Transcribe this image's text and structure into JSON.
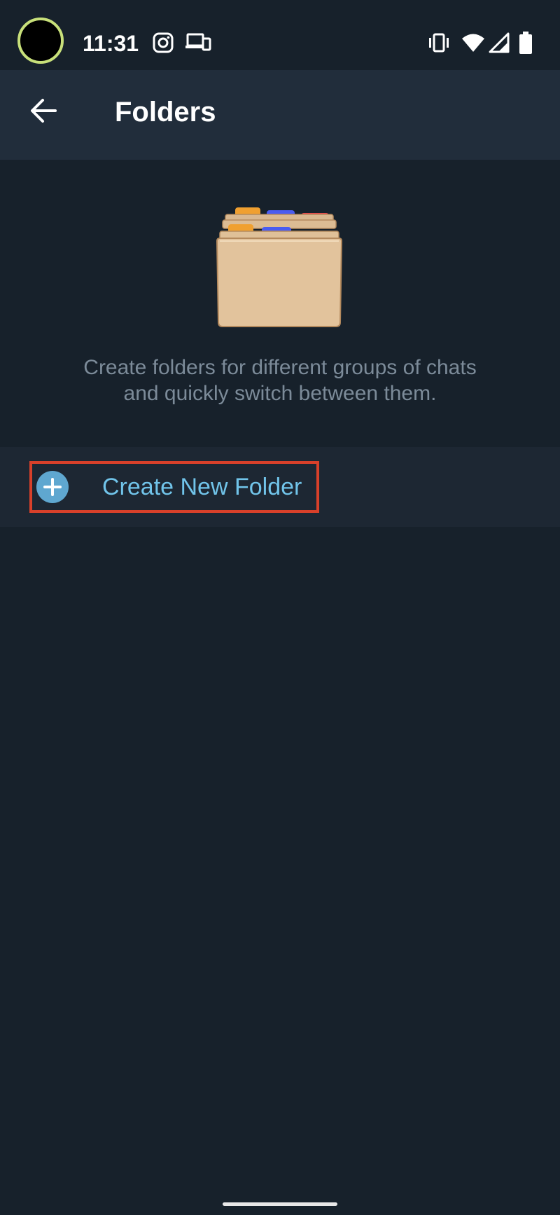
{
  "status_bar": {
    "time": "11:31",
    "left_icons": [
      "instagram-icon",
      "devices-icon"
    ],
    "right_icons": [
      "vibrate-icon",
      "wifi-icon",
      "signal-icon",
      "battery-icon"
    ]
  },
  "app_bar": {
    "title": "Folders",
    "back_icon": "arrow-back-icon"
  },
  "hero": {
    "illustration": "folders-illustration",
    "description_line1": "Create folders for different groups of chats",
    "description_line2": "and quickly switch between them."
  },
  "actions": {
    "create_folder_label": "Create New Folder",
    "create_folder_icon": "plus-circle-icon"
  },
  "colors": {
    "background": "#17212b",
    "app_bar": "#212d3b",
    "accent": "#71c4ea",
    "highlight_border": "#d8402a",
    "secondary_text": "#7c8b99"
  }
}
